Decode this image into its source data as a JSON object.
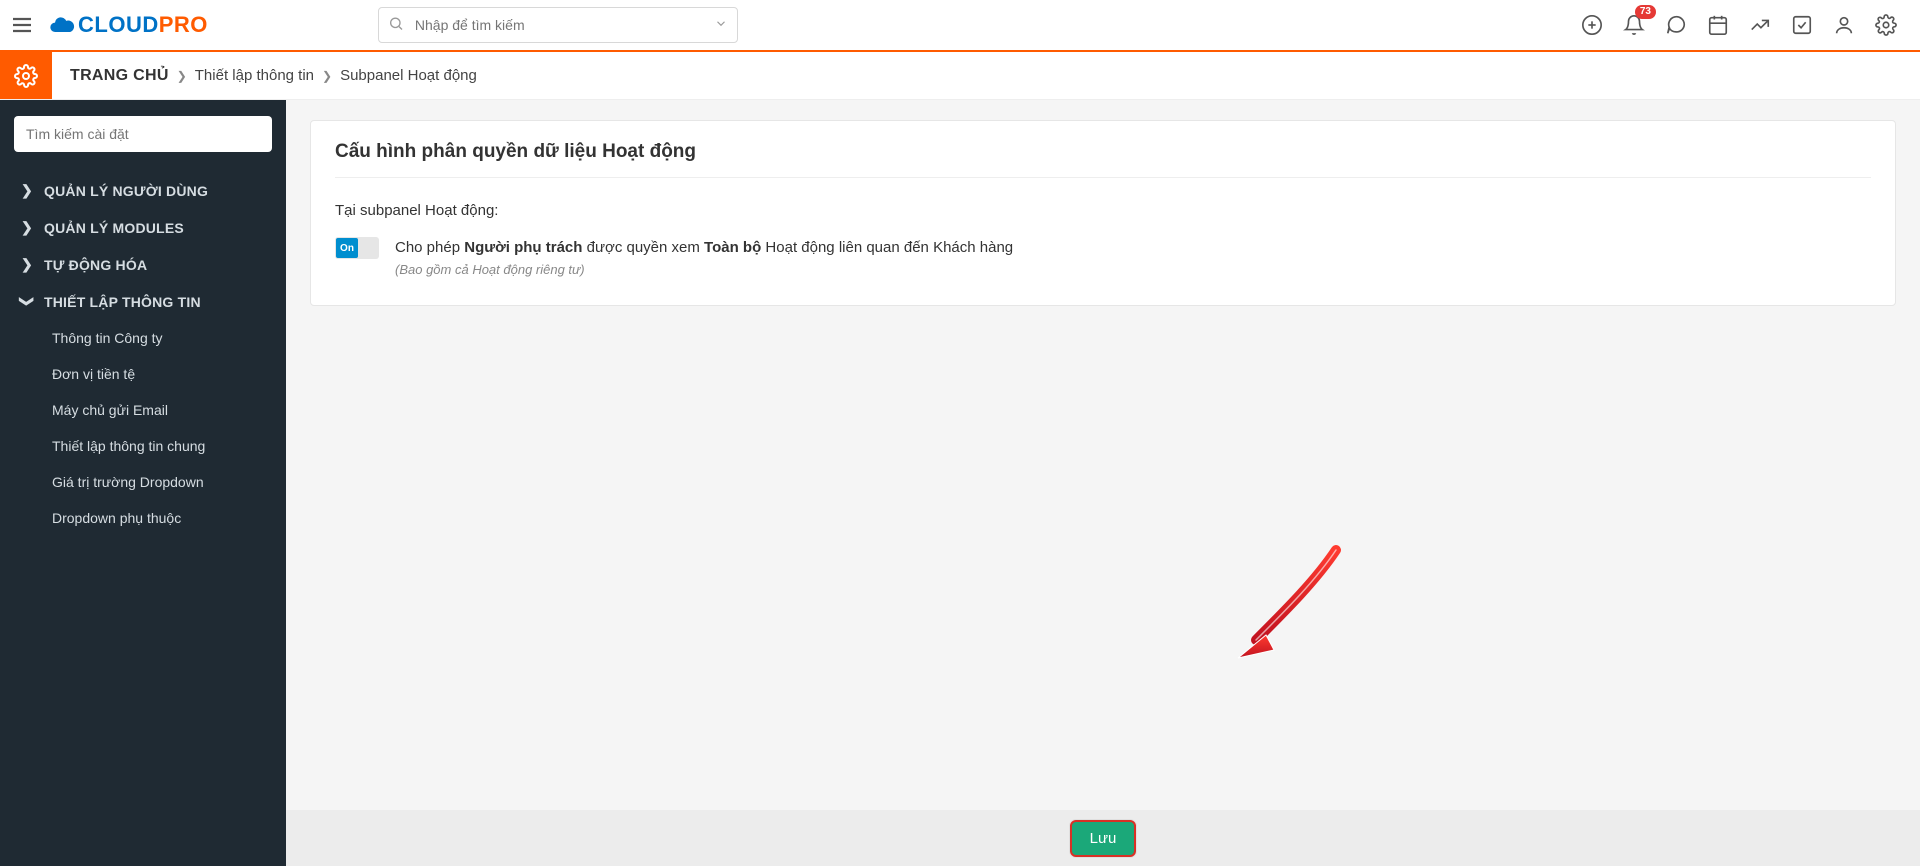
{
  "header": {
    "logo_c": "CLOUD",
    "logo_p": "PRO",
    "search_placeholder": "Nhập để tìm kiếm",
    "notification_count": "73"
  },
  "breadcrumb": {
    "home": "TRANG CHỦ",
    "crumb1": "Thiết lập thông tin",
    "crumb2": "Subpanel Hoạt động"
  },
  "sidebar": {
    "search_placeholder": "Tìm kiếm cài đặt",
    "groups": {
      "g1": "QUẢN LÝ NGƯỜI DÙNG",
      "g2": "QUẢN LÝ MODULES",
      "g3": "TỰ ĐỘNG HÓA",
      "g4": "THIẾT LẬP THÔNG TIN"
    },
    "sub": {
      "s1": "Thông tin Công ty",
      "s2": "Đơn vị tiền tệ",
      "s3": "Máy chủ gửi Email",
      "s4": "Thiết lập thông tin chung",
      "s5": "Giá trị trường Dropdown",
      "s6": "Dropdown phụ thuộc"
    }
  },
  "main": {
    "title": "Cấu hình phân quyền dữ liệu Hoạt động",
    "section_label": "Tại subpanel Hoạt động:",
    "toggle_label": "On",
    "perm_p1": "Cho phép ",
    "perm_b1": "Người phụ trách",
    "perm_p2": " được quyền xem ",
    "perm_b2": "Toàn bộ",
    "perm_p3": " Hoạt động liên quan đến Khách hàng",
    "perm_note": "(Bao gồm cả Hoạt động riêng tư)",
    "save_label": "Lưu"
  }
}
